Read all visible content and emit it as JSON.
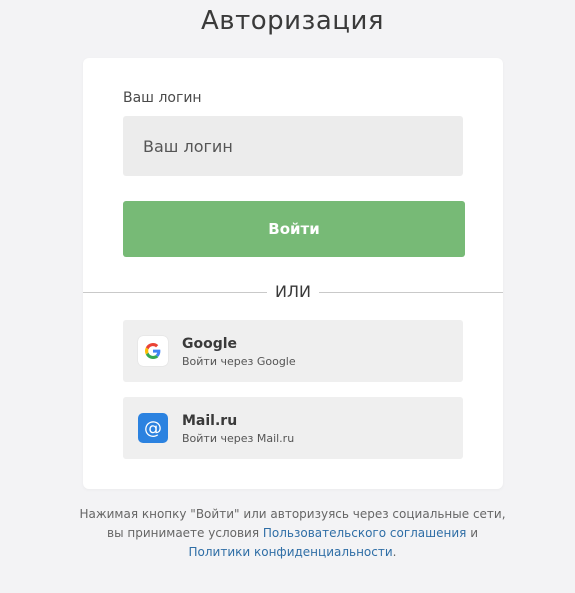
{
  "page": {
    "title": "Авторизация"
  },
  "form": {
    "login_label": "Ваш логин",
    "login_placeholder": "Ваш логин",
    "login_value": "",
    "submit_label": "Войти",
    "divider_text": "ИЛИ"
  },
  "social": [
    {
      "name": "Google",
      "subtitle": "Войти через Google",
      "icon": "google-icon"
    },
    {
      "name": "Mail.ru",
      "subtitle": "Войти через Mail.ru",
      "icon": "at-sign-icon"
    }
  ],
  "footer": {
    "line1": "Нажимая кнопку \"Войти\" или авторизуясь через социальные сети,",
    "line2_prefix": "вы принимаете условия ",
    "agreement_link": "Пользовательского соглашения",
    "line2_suffix": " и",
    "privacy_link": "Политики конфиденциальности",
    "line3_suffix": "."
  },
  "colors": {
    "background": "#f3f3f5",
    "card": "#ffffff",
    "input_bg": "#ececec",
    "submit": "#77ba76",
    "social_bg": "#efefef",
    "mail_icon": "#2b82e0",
    "link": "#2f6ea6"
  }
}
